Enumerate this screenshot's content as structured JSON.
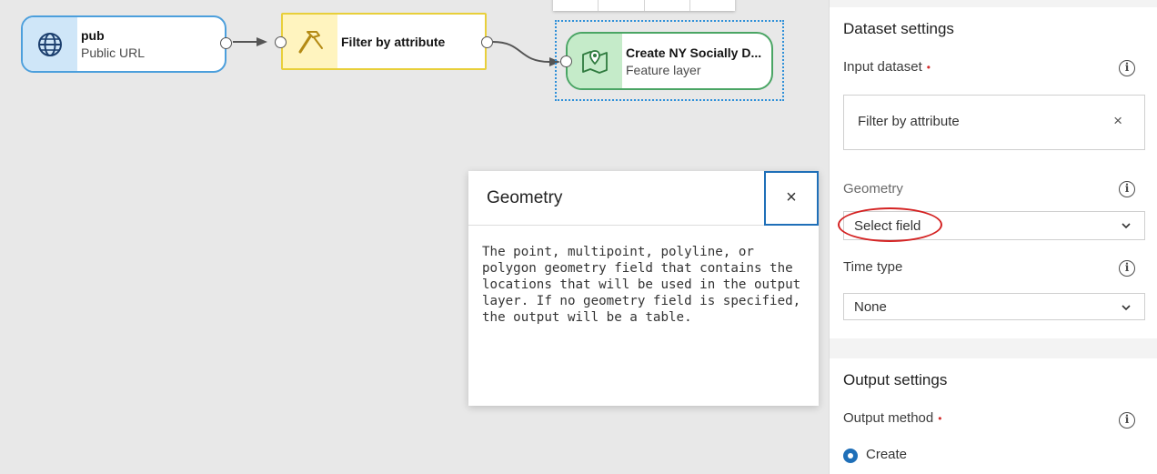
{
  "canvas": {
    "nodes": [
      {
        "title": "pub",
        "subtitle": "Public URL",
        "icon": "globe-icon"
      },
      {
        "title": "Filter by attribute",
        "icon": "hammer-icon"
      },
      {
        "title": "Create NY Socially D...",
        "subtitle": "Feature layer",
        "icon": "map-icon"
      }
    ]
  },
  "popover": {
    "title": "Geometry",
    "close_label": "×",
    "body": "The point, multipoint, polyline, or polygon geometry field that contains the locations that will be used in the output layer. If no geometry field is specified, the output will be a table."
  },
  "panel": {
    "dataset_settings": {
      "title": "Dataset settings",
      "input_dataset_label": "Input dataset",
      "input_dataset_value": "Filter by attribute",
      "geometry_label": "Geometry",
      "geometry_value": "Select field",
      "time_type_label": "Time type",
      "time_type_value": "None"
    },
    "output_settings": {
      "title": "Output settings",
      "output_method_label": "Output method",
      "output_method_option": "Create"
    },
    "required_marker": "•",
    "info_glyph": "i",
    "clear_glyph": "×"
  },
  "colors": {
    "accent": "#1f6fb8",
    "source_border": "#4c9fdc",
    "tool_border": "#e8cf3a",
    "output_border": "#4aa564",
    "highlight": "#d42222"
  }
}
